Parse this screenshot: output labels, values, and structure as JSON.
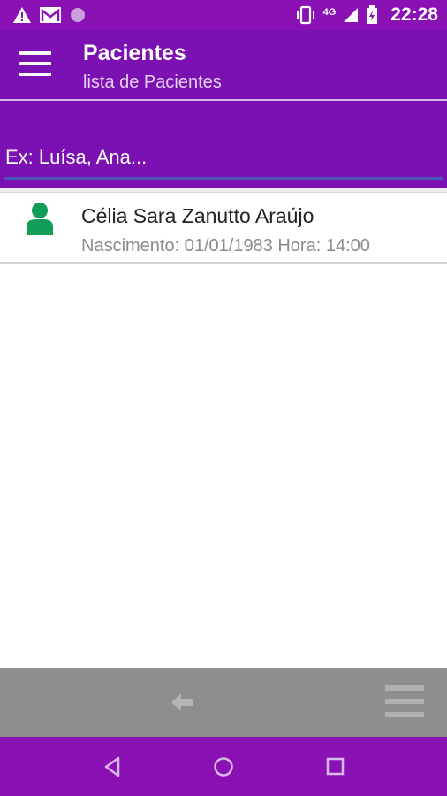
{
  "status_bar": {
    "network": "4G",
    "time": "22:28",
    "icons": [
      "warning-icon",
      "gmail-icon",
      "circle-notification-icon",
      "vibrate-icon",
      "signal-icon",
      "battery-charging-icon"
    ]
  },
  "app_bar": {
    "title": "Pacientes",
    "subtitle": "lista de Pacientes",
    "menu_icon": "hamburger-menu-icon"
  },
  "search": {
    "placeholder": "Ex: Luísa, Ana..."
  },
  "patients": [
    {
      "name": "Célia Sara Zanutto Araújo",
      "details": "Nascimento: 01/01/1983 Hora: 14:00",
      "icon": "person-icon",
      "icon_color": "#0f9d58"
    }
  ],
  "bottom_toolbar": {
    "back_icon": "arrow-left-icon",
    "menu_icon": "menu-lines-icon"
  },
  "nav_bar": {
    "buttons": [
      "nav-back-icon",
      "nav-home-icon",
      "nav-recents-icon"
    ]
  },
  "colors": {
    "primary": "#7b10b3",
    "status_bar": "#8a12b4",
    "search_underline": "#4a58b5",
    "toolbar": "#8e8e8e"
  }
}
